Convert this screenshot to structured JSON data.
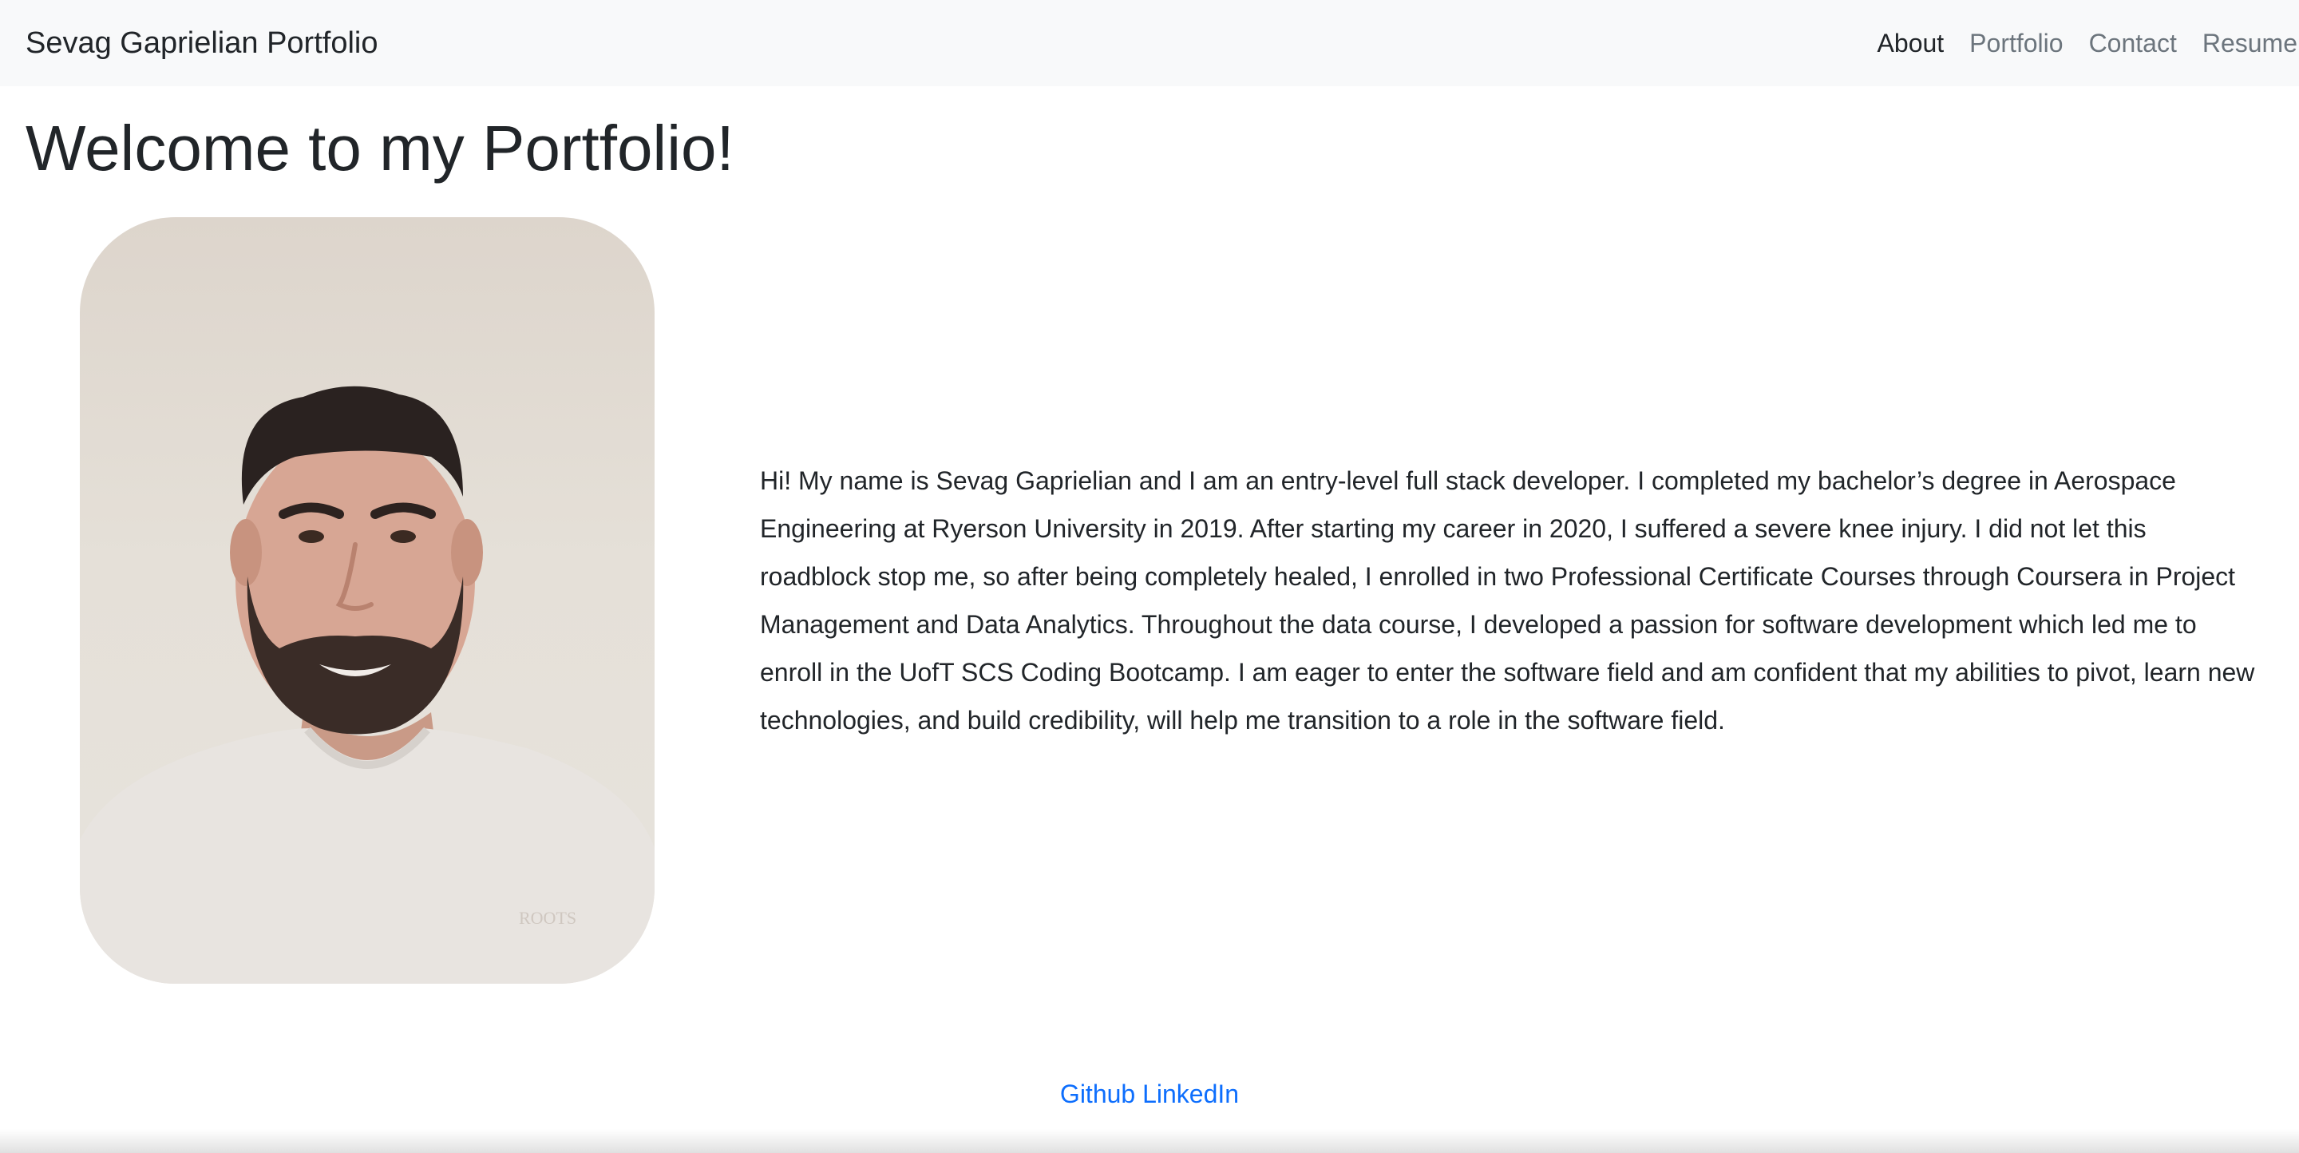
{
  "navbar": {
    "brand": "Sevag Gaprielian Portfolio",
    "links": [
      {
        "label": "About"
      },
      {
        "label": "Portfolio"
      },
      {
        "label": "Contact"
      },
      {
        "label": "Resume"
      }
    ]
  },
  "main": {
    "title": "Welcome to my Portfolio!",
    "bio": "Hi! My name is Sevag Gaprielian and I am an entry-level full stack developer. I completed my bachelor’s degree in Aerospace Engineering at Ryerson University in 2019. After starting my career in 2020, I suffered a severe knee injury. I did not let this roadblock stop me, so after being completely healed, I enrolled in two Professional Certificate Courses through Coursera in Project Management and Data Analytics. Throughout the data course, I developed a passion for software development which led me to enroll in the UofT SCS Coding Bootcamp. I am eager to enter the software field and am confident that my abilities to pivot, learn new technologies, and build credibility, will help me transition to a role in the software field.",
    "photo": {
      "shirt_logo": "ROOTS"
    }
  },
  "footer": {
    "github": "Github",
    "linkedin": "LinkedIn"
  },
  "colors": {
    "navbar_bg": "#f8f9fa",
    "link_muted": "#6c757d",
    "link_active": "#212529",
    "footer_link": "#0d6efd"
  }
}
